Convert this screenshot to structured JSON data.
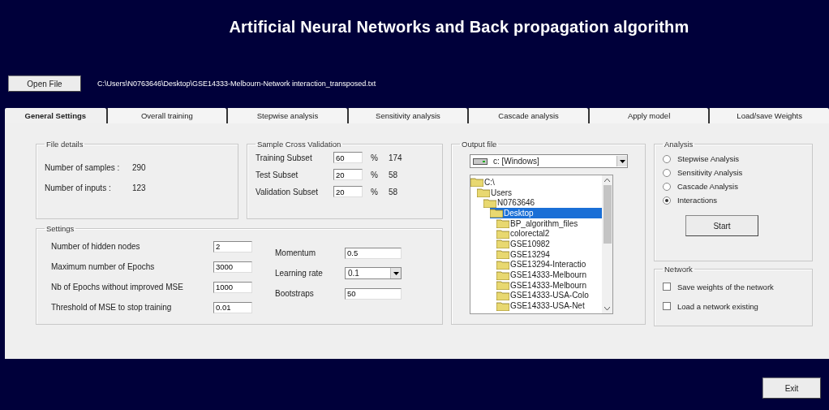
{
  "title": "Artificial Neural Networks and Back propagation algorithm",
  "open_file": {
    "button": "Open File",
    "path": "C:\\Users\\N0763646\\Desktop\\GSE14333-Melbourn-Network interaction_transposed.txt"
  },
  "tabs": [
    {
      "label": "General Settings",
      "selected": true
    },
    {
      "label": "Overall training",
      "selected": false
    },
    {
      "label": "Stepwise analysis",
      "selected": false
    },
    {
      "label": "Sensitivity analysis",
      "selected": false
    },
    {
      "label": "Cascade analysis",
      "selected": false
    },
    {
      "label": "Apply model",
      "selected": false
    },
    {
      "label": "Load/save Weights",
      "selected": false
    }
  ],
  "file_details": {
    "title": "File details",
    "rows": [
      {
        "label": "Number of samples :",
        "value": "290"
      },
      {
        "label": "Number of inputs :",
        "value": "123"
      }
    ]
  },
  "cross_validation": {
    "title": "Sample Cross Validation",
    "rows": [
      {
        "label": "Training Subset",
        "value": "60",
        "unit": "%",
        "count": "174"
      },
      {
        "label": "Test Subset",
        "value": "20",
        "unit": "%",
        "count": "58"
      },
      {
        "label": "Validation Subset",
        "value": "20",
        "unit": "%",
        "count": "58"
      }
    ]
  },
  "settings": {
    "title": "Settings",
    "left": [
      {
        "label": "Number of hidden nodes",
        "value": "2",
        "kind": "field"
      },
      {
        "label": "Maximum number of Epochs",
        "value": "3000",
        "kind": "field"
      },
      {
        "label": "Nb of Epochs without improved MSE",
        "value": "1000",
        "kind": "field"
      },
      {
        "label": "Threshold of MSE to stop training",
        "value": "0.01",
        "kind": "field"
      }
    ],
    "right": [
      {
        "label": "Momentum",
        "value": "0.5",
        "kind": "field"
      },
      {
        "label": "Learning rate",
        "value": "0.1",
        "kind": "dropdown"
      },
      {
        "label": "Bootstraps",
        "value": "50",
        "kind": "field"
      }
    ]
  },
  "output_file": {
    "title": "Output file",
    "drive": "c: [Windows]",
    "tree": [
      {
        "label": "C:\\",
        "selected": false,
        "children": [
          {
            "label": "Users",
            "selected": false,
            "children": [
              {
                "label": "N0763646",
                "selected": false,
                "children": [
                  {
                    "label": "Desktop",
                    "selected": true,
                    "children": [
                      {
                        "label": "BP_algorithm_files",
                        "selected": false
                      },
                      {
                        "label": "colorectal2",
                        "selected": false
                      },
                      {
                        "label": "GSE10982",
                        "selected": false
                      },
                      {
                        "label": "GSE13294",
                        "selected": false
                      },
                      {
                        "label": "GSE13294-Interactio",
                        "selected": false
                      },
                      {
                        "label": "GSE14333-Melbourn",
                        "selected": false
                      },
                      {
                        "label": "GSE14333-Melbourn",
                        "selected": false
                      },
                      {
                        "label": "GSE14333-USA-Colo",
                        "selected": false
                      },
                      {
                        "label": "GSE14333-USA-Net",
                        "selected": false
                      }
                    ]
                  }
                ]
              }
            ]
          }
        ]
      }
    ]
  },
  "analysis": {
    "title": "Analysis",
    "options": [
      {
        "label": "Stepwise Analysis",
        "selected": false
      },
      {
        "label": "Sensitivity Analysis",
        "selected": false
      },
      {
        "label": "Cascade Analysis",
        "selected": false
      },
      {
        "label": "Interactions",
        "selected": true
      }
    ],
    "button": "Start"
  },
  "network": {
    "title": "Network",
    "options": [
      {
        "label": "Save weights of the network",
        "checked": false
      },
      {
        "label": "Load a network existing",
        "checked": false
      }
    ]
  },
  "exit_button": "Exit"
}
